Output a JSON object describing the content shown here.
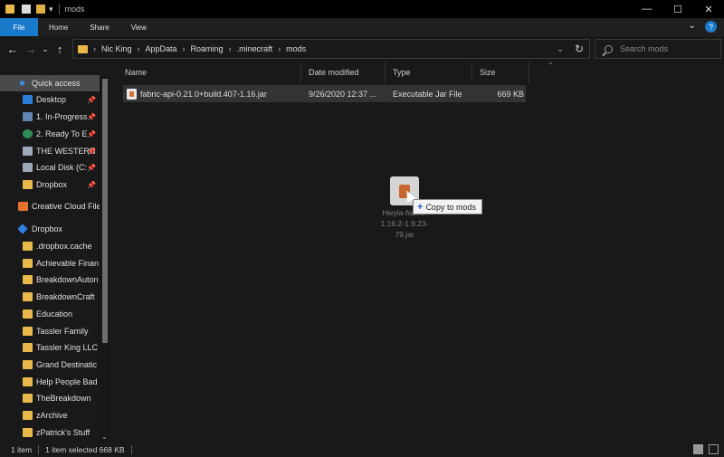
{
  "window": {
    "title": "mods",
    "controls": {
      "minimize": "—",
      "maximize": "☐",
      "close": "✕"
    }
  },
  "ribbon": {
    "tabs": [
      "File",
      "Home",
      "Share",
      "View"
    ],
    "expand_glyph": "⌄",
    "help_glyph": "?"
  },
  "nav": {
    "back": "←",
    "forward": "→",
    "recent": "⌄",
    "up": "↑",
    "breadcrumbs": [
      "Nic King",
      "AppData",
      "Roaming",
      ".minecraft",
      "mods"
    ],
    "search_placeholder": "Search mods"
  },
  "sidebar": {
    "items": [
      {
        "label": "Quick access",
        "icon": "star-icon",
        "pinned": false,
        "selected": true
      },
      {
        "label": "Desktop",
        "icon": "desktop-icon",
        "pinned": true
      },
      {
        "label": "1. In-Progress",
        "icon": "document-icon",
        "pinned": true
      },
      {
        "label": "2. Ready To E",
        "icon": "globe-icon",
        "pinned": true
      },
      {
        "label": "THE WESTERN",
        "icon": "drive-icon",
        "pinned": true
      },
      {
        "label": "Local Disk (C:",
        "icon": "drive-icon",
        "pinned": true
      },
      {
        "label": "Dropbox",
        "icon": "folder-icon",
        "pinned": true
      },
      {
        "label": "Creative Cloud File",
        "icon": "creative-cloud-icon",
        "pinned": false
      },
      {
        "label": "Dropbox",
        "icon": "dropbox-icon",
        "pinned": false
      },
      {
        "label": ".dropbox.cache",
        "icon": "folder-icon",
        "pinned": false
      },
      {
        "label": "Achievable Finan",
        "icon": "folder-icon",
        "pinned": false
      },
      {
        "label": "BreakdownAuton",
        "icon": "folder-icon",
        "pinned": false
      },
      {
        "label": "BreakdownCraft",
        "icon": "folder-icon",
        "pinned": false
      },
      {
        "label": "Education",
        "icon": "folder-icon",
        "pinned": false
      },
      {
        "label": "Tassler Family",
        "icon": "folder-icon",
        "pinned": false
      },
      {
        "label": "Tassler King LLC",
        "icon": "folder-icon",
        "pinned": false
      },
      {
        "label": "Grand Destinatic",
        "icon": "folder-icon",
        "pinned": false
      },
      {
        "label": "Help People Bad",
        "icon": "folder-icon",
        "pinned": false
      },
      {
        "label": "TheBreakdown",
        "icon": "folder-icon",
        "pinned": false
      },
      {
        "label": "zArchive",
        "icon": "folder-icon",
        "pinned": false
      },
      {
        "label": "zPatrick's Stuff",
        "icon": "folder-icon",
        "pinned": false
      }
    ]
  },
  "columns": [
    "Name",
    "Date modified",
    "Type",
    "Size"
  ],
  "files": [
    {
      "name": "fabric-api-0.21.0+build.407-1.16.jar",
      "date": "9/26/2020 12:37 ...",
      "type": "Executable Jar File",
      "size": "669 KB"
    }
  ],
  "drag": {
    "name_lines": [
      "Hwyla-fabric-",
      "1.16.2-1.9.23-",
      "79.jar"
    ],
    "tooltip": "Copy to mods"
  },
  "status": {
    "items": "1 item",
    "selected": "1 item selected  668 KB"
  },
  "colors": {
    "accent": "#1979ca",
    "background": "#191919",
    "selection": "#333333"
  }
}
